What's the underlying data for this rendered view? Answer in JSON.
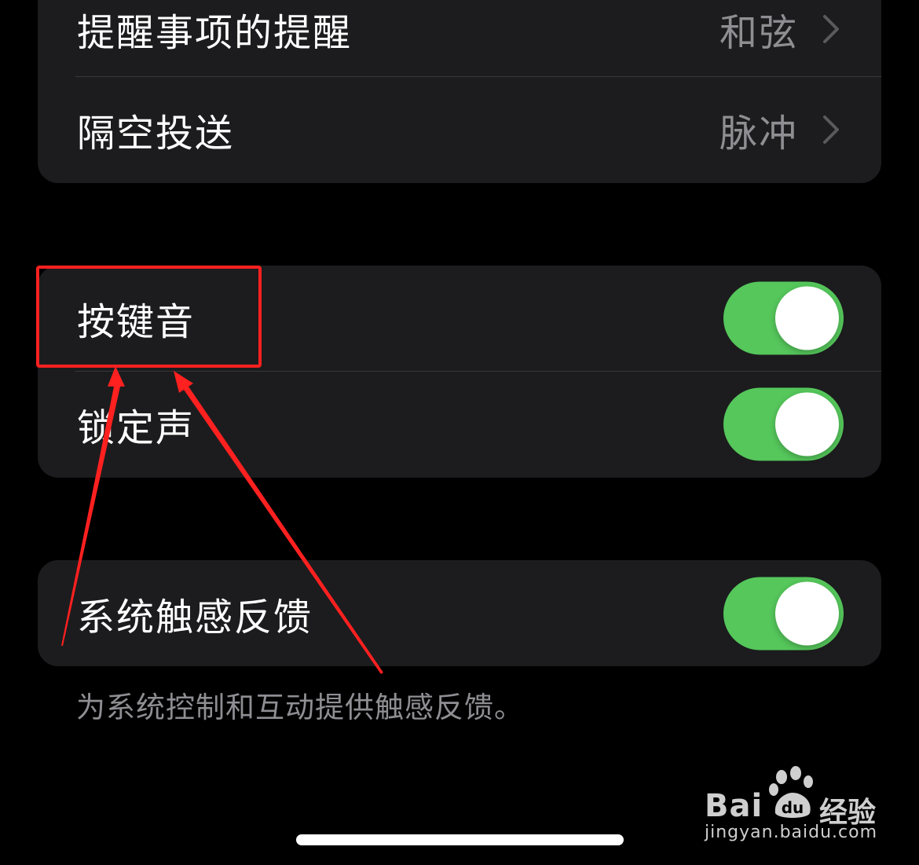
{
  "settings": {
    "top_group": [
      {
        "label": "提醒事项的提醒",
        "value": "和弦"
      },
      {
        "label": "隔空投送",
        "value": "脉冲"
      }
    ],
    "sounds_group": [
      {
        "label": "按键音",
        "toggle": "on"
      },
      {
        "label": "锁定声",
        "toggle": "on"
      }
    ],
    "haptics_group": [
      {
        "label": "系统触感反馈",
        "toggle": "on"
      }
    ],
    "haptics_footer": "为系统控制和互动提供触感反馈。"
  },
  "colors": {
    "background": "#000000",
    "group_background": "#1c1c1e",
    "toggle_on": "#55c75b",
    "secondary_text": "#8e8e93",
    "annotation": "#ff2020"
  },
  "watermark": {
    "brand": "Bai",
    "brand_du": "du",
    "product": "经验",
    "url": "jingyan.baidu.com"
  }
}
